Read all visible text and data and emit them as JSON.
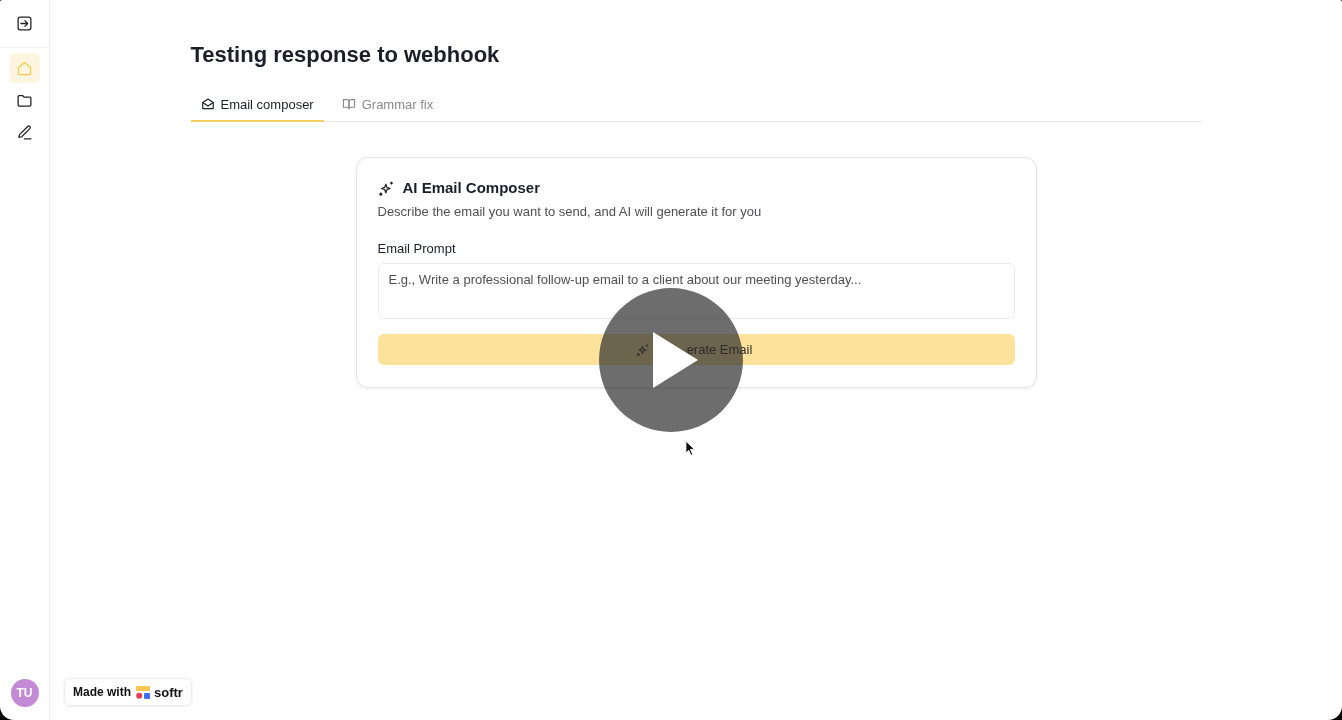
{
  "sidebar": {
    "nav_items": [
      {
        "selected": true
      },
      {
        "selected": false
      },
      {
        "selected": false
      }
    ],
    "avatar": {
      "initials": "TU"
    }
  },
  "page": {
    "title": "Testing response to webhook",
    "tabs": [
      {
        "label": "Email composer",
        "selected": true
      },
      {
        "label": "Grammar fix",
        "selected": false
      }
    ]
  },
  "card": {
    "title": "AI Email Composer",
    "description": "Describe the email you want to send, and AI will generate it for you",
    "prompt_label": "Email Prompt",
    "prompt_field": {
      "placeholder": "E.g., Write a professional follow-up email to a client about our meeting yesterday..."
    },
    "generate_button": {
      "label": "erate Email"
    }
  },
  "badge": {
    "text": "Made with",
    "brand": "softr"
  }
}
